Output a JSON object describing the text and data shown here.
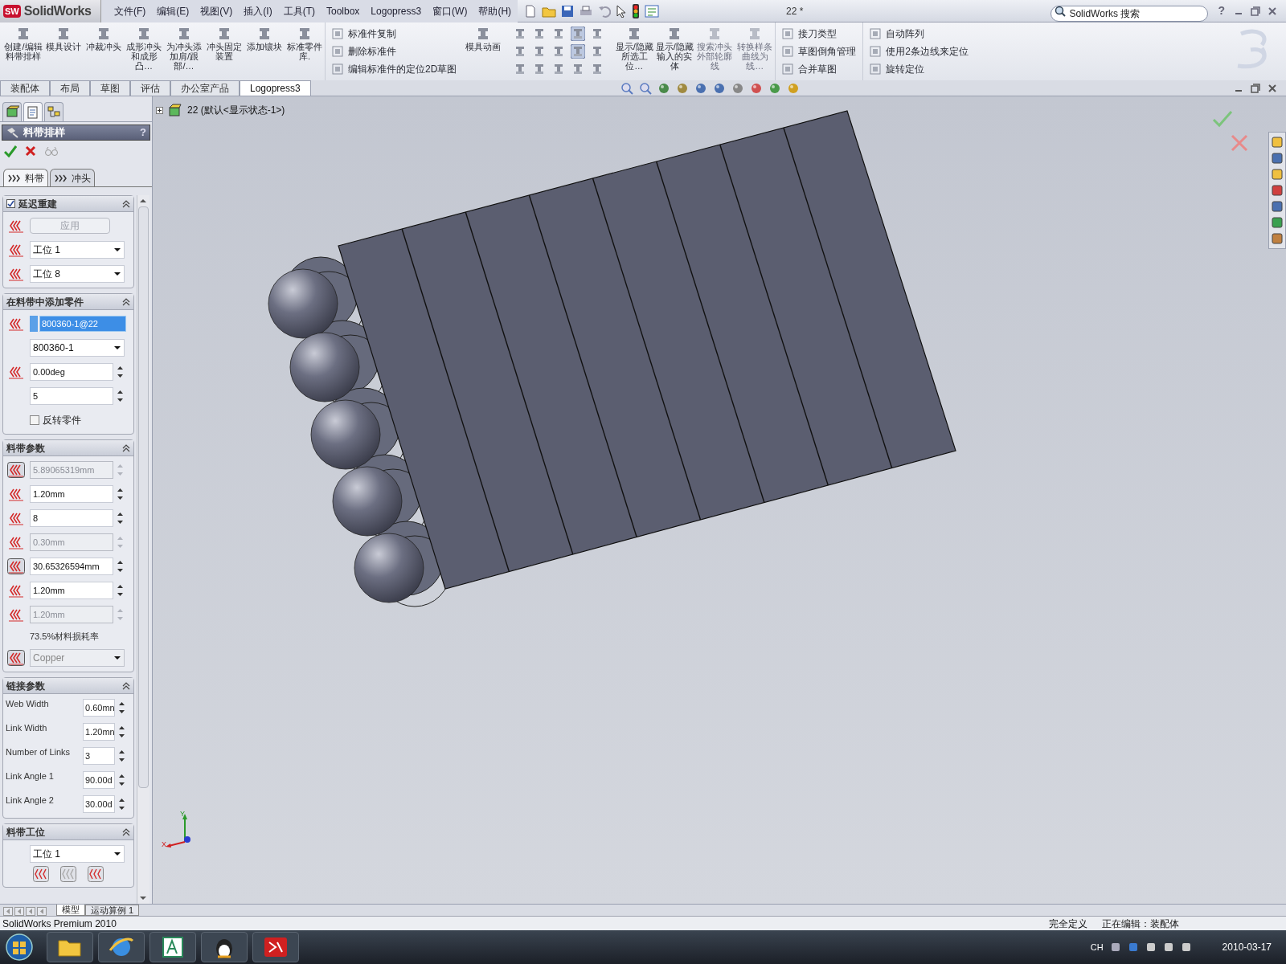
{
  "app": {
    "badge": "SW",
    "logo": "SolidWorks"
  },
  "menu": [
    "文件(F)",
    "编辑(E)",
    "视图(V)",
    "插入(I)",
    "工具(T)",
    "Toolbox",
    "Logopress3",
    "窗口(W)",
    "帮助(H)"
  ],
  "document_title": "22 *",
  "search": {
    "placeholder": "SolidWorks 搜索"
  },
  "help": "?",
  "ribbon": [
    {
      "kind": "large",
      "label": "创建/编辑料带排样",
      "disabled": false
    },
    {
      "kind": "large",
      "label": "模具设计",
      "disabled": false
    },
    {
      "kind": "large",
      "label": "冲裁冲头",
      "disabled": false
    },
    {
      "kind": "large",
      "label": "成形冲头和成形凸…",
      "disabled": false
    },
    {
      "kind": "large",
      "label": "为冲头添加肩/跟部/…",
      "disabled": false
    },
    {
      "kind": "large",
      "label": "冲头固定装置",
      "disabled": false
    },
    {
      "kind": "large",
      "label": "添加镶块",
      "disabled": false
    },
    {
      "kind": "large",
      "label": "标准零件库.",
      "disabled": false
    },
    {
      "kind": "stack",
      "items": [
        "标准件复制",
        "删除标准件",
        "编辑标准件的定位2D草图"
      ]
    },
    {
      "kind": "large",
      "label": "模具动画",
      "disabled": false
    },
    {
      "kind": "grid"
    },
    {
      "kind": "large",
      "label": "显示/隐藏所选工位…",
      "disabled": false
    },
    {
      "kind": "large",
      "label": "显示/隐藏输入的实体",
      "disabled": false
    },
    {
      "kind": "large",
      "label": "搜索冲头外部轮廓线",
      "disabled": true
    },
    {
      "kind": "large",
      "label": "转换样条曲线为线…",
      "disabled": true
    },
    {
      "kind": "stack",
      "items": [
        "接刀类型",
        "草图倒角管理",
        "合并草图"
      ]
    },
    {
      "kind": "stack",
      "items": [
        "自动阵列",
        "使用2条边线来定位",
        "旋转定位"
      ]
    }
  ],
  "command_tabs": [
    {
      "label": "装配体",
      "selected": false
    },
    {
      "label": "布局",
      "selected": false
    },
    {
      "label": "草图",
      "selected": false
    },
    {
      "label": "评估",
      "selected": false
    },
    {
      "label": "办公室产品",
      "selected": false
    },
    {
      "label": "Logopress3",
      "selected": true
    }
  ],
  "manager_tabs": [
    {
      "selected": false
    },
    {
      "selected": true
    },
    {
      "selected": false
    }
  ],
  "panel": {
    "title": "料带排样",
    "help": "?",
    "tabs": [
      {
        "label": "料带",
        "selected": true
      },
      {
        "label": "冲头",
        "selected": false
      }
    ],
    "groups": [
      {
        "title": "延迟重建",
        "checked": true,
        "rows": [
          {
            "kind": "button",
            "label": "应用",
            "disabled": true,
            "icon": true
          },
          {
            "kind": "select",
            "value": "工位 1",
            "icon": true
          },
          {
            "kind": "select",
            "value": "工位 8",
            "icon": true
          }
        ]
      },
      {
        "title": "在料带中添加零件",
        "rows": [
          {
            "kind": "selection",
            "value": "800360-1@22",
            "icon": true
          },
          {
            "kind": "select",
            "value": "800360-1",
            "icon": false
          },
          {
            "kind": "spin",
            "value": "0.00deg",
            "disabled": false,
            "icon": true
          },
          {
            "kind": "spin",
            "value": "5",
            "disabled": false,
            "icon": false
          },
          {
            "kind": "checkbox",
            "label": "反转零件",
            "checked": false
          }
        ]
      },
      {
        "title": "料带参数",
        "rows": [
          {
            "kind": "spin",
            "value": "5.89065319mm",
            "disabled": true,
            "icon": true
          },
          {
            "kind": "spin",
            "value": "1.20mm",
            "disabled": false,
            "icon": true
          },
          {
            "kind": "spin",
            "value": "8",
            "disabled": false,
            "icon": true
          },
          {
            "kind": "spin",
            "value": "0.30mm",
            "disabled": true,
            "icon": true
          },
          {
            "kind": "spin",
            "value": "30.65326594mm",
            "disabled": false,
            "icon": true
          },
          {
            "kind": "spin",
            "value": "1.20mm",
            "disabled": false,
            "icon": true
          },
          {
            "kind": "spin",
            "value": "1.20mm",
            "disabled": true,
            "icon": true
          },
          {
            "kind": "text",
            "label": "73.5%材料损耗率"
          },
          {
            "kind": "select",
            "value": "Copper",
            "disabled": true,
            "icon": true
          }
        ]
      },
      {
        "title": "链接参数",
        "rows": [
          {
            "kind": "labeled",
            "label": "Web Width",
            "value": "0.60mn"
          },
          {
            "kind": "labeled",
            "label": "Link Width",
            "value": "1.20mn"
          },
          {
            "kind": "labeled",
            "label": "Number of Links",
            "value": "3"
          },
          {
            "kind": "labeled",
            "label": "Link Angle 1",
            "value": "90.00d"
          },
          {
            "kind": "labeled",
            "label": "Link Angle 2",
            "value": "30.00d"
          }
        ]
      },
      {
        "title": "料带工位",
        "rows": [
          {
            "kind": "select",
            "value": "工位 1",
            "icon": false
          },
          {
            "kind": "icons"
          }
        ]
      }
    ]
  },
  "tree": {
    "label": "22 (默认<显示状态-1>)"
  },
  "triad": {
    "x": "X",
    "y": "Y"
  },
  "bottom_tabs": [
    {
      "label": "模型",
      "selected": true
    },
    {
      "label": "运动算例 1",
      "selected": false
    }
  ],
  "status_bar": [
    "SolidWorks Premium 2010",
    "完全定义",
    "正在编辑：装配体"
  ],
  "taskbar": {
    "language": "CH",
    "date": "2010-03-17"
  }
}
